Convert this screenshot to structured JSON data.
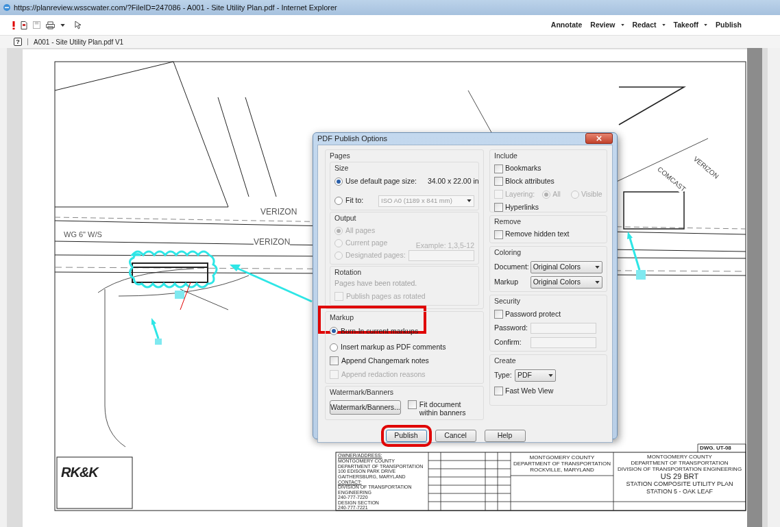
{
  "browser": {
    "title": "https://planreview.wsscwater.com/?FileID=247086 - A001 - Site Utility Plan.pdf - Internet Explorer"
  },
  "toolbar": {
    "menus": [
      {
        "label": "Annotate",
        "dropdown": false
      },
      {
        "label": "Review",
        "dropdown": true
      },
      {
        "label": "Redact",
        "dropdown": true
      },
      {
        "label": "Takeoff",
        "dropdown": true
      },
      {
        "label": "Publish",
        "dropdown": false
      }
    ]
  },
  "document_tab": {
    "help": "?",
    "label": "A001 - Site Utility Plan.pdf V1"
  },
  "plan": {
    "labels": [
      "VERIZON",
      "VERIZON",
      "WG 6\" W/S",
      "COMCAST",
      "VERIZON"
    ],
    "title_block": {
      "logo": "RK&K",
      "dwg": "DWG. UT-08",
      "owner": [
        "OWNER/ADDRESS:",
        "MONTGOMERY COUNTY",
        "DEPARTMENT OF TRANSPORTATION",
        "100 EDISON PARK DRIVE",
        "GAITHERSBURG, MARYLAND"
      ],
      "contact": [
        "CONTACT:",
        "DIVISION OF TRANSPORTATION",
        "ENGINEERING",
        "240-777-7220",
        "DESIGN SECTION",
        "240-777-7221"
      ],
      "agency": [
        "MONTGOMERY COUNTY",
        "DEPARTMENT OF TRANSPORTATION",
        "ROCKVILLE, MARYLAND"
      ],
      "project_header": [
        "MONTGOMERY COUNTY",
        "DEPARTMENT OF TRANSPORTATION",
        "DIVISION OF TRANSPORTATION ENGINEERING"
      ],
      "project_title": [
        "US 29 BRT",
        "STATION COMPOSITE UTILITY PLAN",
        "STATION 5 - OAK LEAF"
      ]
    }
  },
  "dialog": {
    "title": "PDF Publish Options",
    "pages": {
      "title": "Pages",
      "size": {
        "title": "Size",
        "options": [
          {
            "label": "Use default page size:",
            "selected": true,
            "value": "34.00 x 22.00 in"
          },
          {
            "label": "Fit to:",
            "selected": false,
            "select": "ISO A0 (1189 x 841 mm)"
          }
        ]
      },
      "output": {
        "title": "Output",
        "disabled": true,
        "options": [
          {
            "label": "All pages",
            "selected": true
          },
          {
            "label": "Current page",
            "selected": false
          },
          {
            "label": "Designated pages:",
            "selected": false
          }
        ],
        "example": "Example: 1,3,5-12"
      },
      "rotation": {
        "title": "Rotation",
        "note": "Pages have been rotated.",
        "checkbox": {
          "label": "Publish pages as rotated",
          "checked": false,
          "disabled": true
        }
      }
    },
    "markup": {
      "title": "Markup",
      "highlighted": true,
      "items": [
        {
          "kind": "radio",
          "label": "Burn-In current markups",
          "selected": true,
          "disabled": false
        },
        {
          "kind": "radio",
          "label": "Insert markup as PDF comments",
          "selected": false,
          "disabled": false
        },
        {
          "kind": "checkbox",
          "label": "Append Changemark notes",
          "checked": false,
          "disabled": false
        },
        {
          "kind": "checkbox",
          "label": "Append redaction reasons",
          "checked": false,
          "disabled": true
        }
      ]
    },
    "watermark": {
      "title": "Watermark/Banners",
      "button": "Watermark/Banners...",
      "checkbox": {
        "label": "Fit document within banners",
        "checked": false
      }
    },
    "include": {
      "title": "Include",
      "items": [
        {
          "label": "Bookmarks",
          "checked": false,
          "disabled": false
        },
        {
          "label": "Block attributes",
          "checked": false,
          "disabled": false
        },
        {
          "label": "Layering:",
          "checked": false,
          "disabled": true,
          "radios": [
            {
              "label": "All",
              "selected": true
            },
            {
              "label": "Visible",
              "selected": false
            }
          ]
        },
        {
          "label": "Hyperlinks",
          "checked": false,
          "disabled": false
        }
      ]
    },
    "remove": {
      "title": "Remove",
      "checkbox": {
        "label": "Remove hidden text",
        "checked": false
      }
    },
    "coloring": {
      "title": "Coloring",
      "fields": [
        {
          "label": "Document:",
          "value": "Original Colors"
        },
        {
          "label": "Markup",
          "value": "Original Colors"
        }
      ]
    },
    "security": {
      "title": "Security",
      "checkbox": {
        "label": "Password protect",
        "checked": false
      },
      "fields": [
        {
          "label": "Password:"
        },
        {
          "label": "Confirm:"
        }
      ]
    },
    "create": {
      "title": "Create",
      "type": {
        "label": "Type:",
        "value": "PDF"
      },
      "checkbox": {
        "label": "Fast Web View",
        "checked": false
      }
    },
    "buttons": [
      {
        "label": "Publish",
        "highlighted": true
      },
      {
        "label": "Cancel",
        "highlighted": false
      },
      {
        "label": "Help",
        "highlighted": false
      }
    ]
  }
}
